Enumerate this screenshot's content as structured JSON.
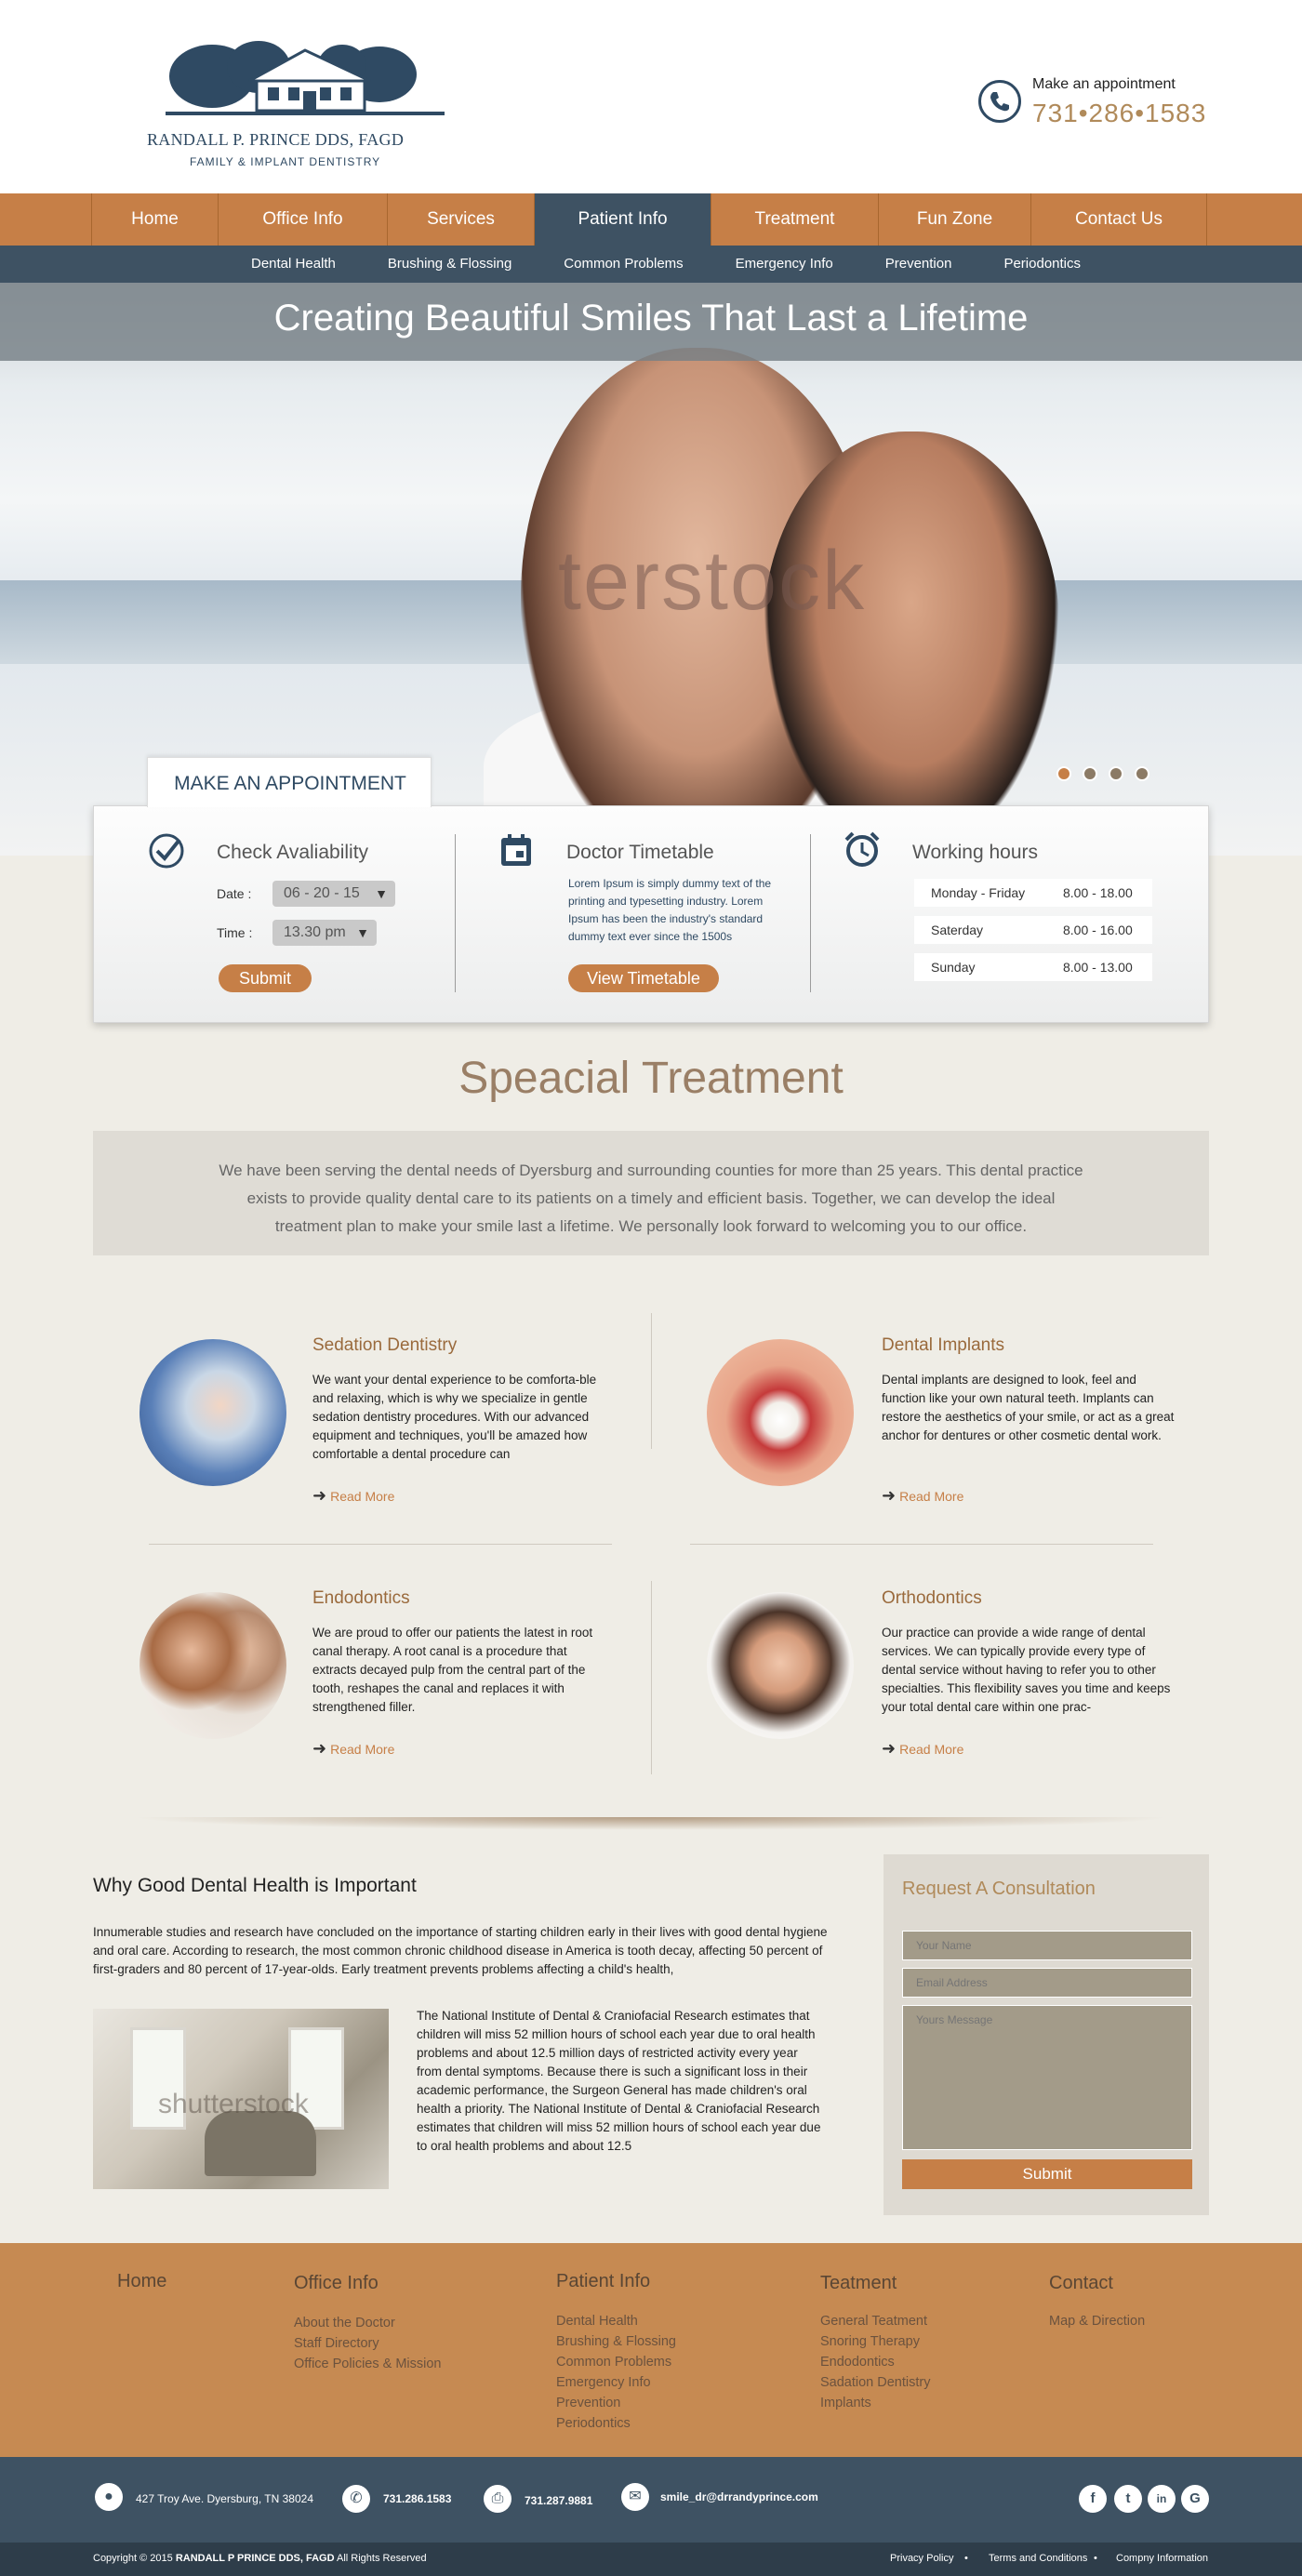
{
  "header": {
    "logo_name": "RANDALL P. PRINCE DDS, FAGD",
    "logo_tagline": "FAMILY & IMPLANT DENTISTRY",
    "appt_label": "Make an appointment",
    "appt_phone": "731•286•1583"
  },
  "nav": {
    "items": [
      "Home",
      "Office Info",
      "Services",
      "Patient Info",
      "Treatment",
      "Fun Zone",
      "Contact Us"
    ],
    "active": "Patient Info"
  },
  "subnav": {
    "items": [
      "Dental Health",
      "Brushing & Flossing",
      "Common Problems",
      "Emergency Info",
      "Prevention",
      "Periodontics"
    ]
  },
  "hero": {
    "title": "Creating Beautiful Smiles That Last a Lifetime",
    "watermark": "terstock",
    "slide_count": 4,
    "active_slide": 1
  },
  "appointment": {
    "tab_label": "MAKE AN APPOINTMENT",
    "availability": {
      "title": "Check Avaliability",
      "date_label": "Date :",
      "date_value": "06 - 20 - 15",
      "time_label": "Time :",
      "time_value": "13.30 pm",
      "submit_label": "Submit"
    },
    "timetable": {
      "title": "Doctor Timetable",
      "text": "Lorem Ipsum is simply dummy text of the printing and typesetting industry. Lorem Ipsum has been the industry's standard dummy text ever since the 1500s",
      "button_label": "View Timetable"
    },
    "hours": {
      "title": "Working hours",
      "rows": [
        {
          "day": "Monday - Friday",
          "time": "8.00 - 18.00"
        },
        {
          "day": "Saterday",
          "time": "8.00 - 16.00"
        },
        {
          "day": "Sunday",
          "time": "8.00 - 13.00"
        }
      ]
    }
  },
  "special": {
    "title": "Speacial Treatment",
    "text": "We have been serving the dental needs of  Dyersburg and surrounding counties for more than 25 years. This dental practice exists to provide quality dental care to its patients on a timely and efficient basis. Together, we can develop the ideal treatment plan to make your smile last a lifetime. We personally look forward to welcoming you to our office."
  },
  "services": [
    {
      "title": "Sedation Dentistry",
      "text": "We want your dental experience to be comforta-ble and relaxing, which is why we specialize in gentle sedation dentistry procedures. With our advanced equipment and techniques, you'll be amazed how comfortable a dental procedure can",
      "link": "Read More"
    },
    {
      "title": "Dental Implants",
      "text": "Dental implants are designed to look, feel and function like your own natural teeth. Implants can restore the aesthetics of your smile, or act as a great anchor for dentures or other cosmetic dental work.",
      "link": "Read More"
    },
    {
      "title": "Endodontics",
      "text": "We are proud to offer our patients the latest in root canal therapy. A root canal is a procedure that extracts decayed pulp from the central part of the tooth, reshapes the canal and replaces it with strengthened filler.",
      "link": "Read More"
    },
    {
      "title": "Orthodontics",
      "text": "Our practice can provide a wide range of dental services. We can typically provide every type of dental service without having to refer you to other specialties. This flexibility saves you time and keeps your total dental care within one prac-",
      "link": "Read More"
    }
  ],
  "why": {
    "title": "Why Good Dental Health is Important",
    "p1": "Innumerable studies and research have concluded on the importance of starting children early in their lives with good dental hygiene and oral care. According to research, the most common chronic childhood disease in America is tooth decay, affecting 50 percent of first-graders and 80 percent of 17-year-olds. Early treatment prevents problems affecting a child's health,",
    "p2": "The National Institute of Dental & Craniofacial Research estimates that children will miss 52 million hours of school each year due to oral health problems and about 12.5 million days of restricted activity every year from dental symptoms. Because there is such a significant loss in their academic performance, the Surgeon General has made children's oral health a priority. The National Institute of Dental & Craniofacial Research estimates that children will miss 52 million hours of school each year due to oral health problems and about 12.5",
    "image_watermark": "shutterstock"
  },
  "consultation": {
    "title": "Request A Consultation",
    "name_placeholder": "Your Name",
    "email_placeholder": "Email Address",
    "message_placeholder": "Yours Message",
    "submit_label": "Submit"
  },
  "footer": {
    "columns": [
      {
        "title": "Home",
        "links": []
      },
      {
        "title": "Office Info",
        "links": [
          "About the Doctor",
          "Staff Directory",
          "Office Policies & Mission"
        ]
      },
      {
        "title": "Patient Info",
        "links": [
          "Dental Health",
          "Brushing & Flossing",
          "Common Problems",
          "Emergency Info",
          "Prevention",
          "Periodontics"
        ]
      },
      {
        "title": "Teatment",
        "links": [
          "General Teatment",
          "Snoring Therapy",
          "Endodontics",
          "Sadation Dentistry",
          "Implants"
        ]
      },
      {
        "title": "Contact",
        "links": [
          "Map & Direction"
        ]
      }
    ]
  },
  "contact_bar": {
    "address": "427 Troy Ave. Dyersburg, TN  38024",
    "phone": "731.286.1583",
    "fax": "731.287.9881",
    "email": "smile_dr@drrandyprince.com",
    "social": [
      "f",
      "t",
      "in",
      "G"
    ]
  },
  "bottom_bar": {
    "copyright_prefix": "Copyright © 2015 ",
    "copyright_name": "RANDALL P PRINCE DDS, FAGD",
    "copyright_suffix": " All Rights Reserved",
    "links": [
      "Privacy Policy",
      "Terms and Conditions",
      "Compny Information"
    ]
  },
  "colors": {
    "orange": "#c67f47",
    "navy": "#3e5263",
    "brown_title": "#9a7f66",
    "page_bg": "#efede6"
  }
}
